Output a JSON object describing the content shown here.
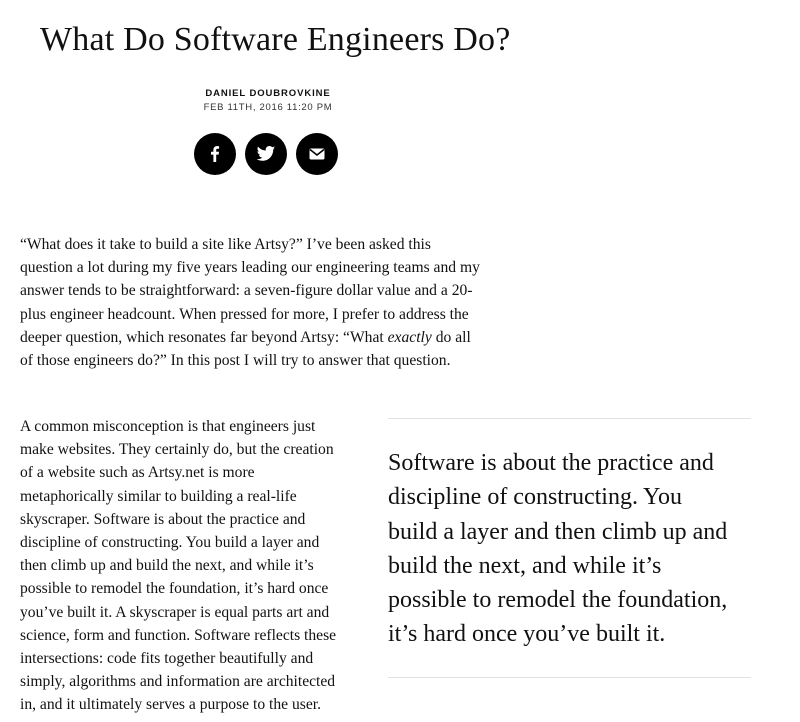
{
  "article": {
    "title": "What Do Software Engineers Do?",
    "author": "DANIEL DOUBROVKINE",
    "date": "FEB 11TH, 2016 11:20 PM"
  },
  "share": {
    "buttons": [
      {
        "name": "facebook",
        "icon": "facebook-icon"
      },
      {
        "name": "twitter",
        "icon": "twitter-icon"
      },
      {
        "name": "email",
        "icon": "envelope-icon"
      }
    ]
  },
  "intro": {
    "text_before": "“What does it take to build a site like Artsy?” I’ve been asked this\nquestion a lot during my five years leading our engineering teams and my\nanswer tends to be straightforward: a seven-figure dollar value and a 20-\nplus engineer headcount. When pressed for more, I prefer to address the\ndeeper question, which resonates far beyond Artsy: “What ",
    "emphasis": "exactly",
    "text_after": " do all\nof those engineers do?” In this post I will try to answer that question."
  },
  "body": {
    "paragraph": "A common misconception is that engineers just\nmake websites. They certainly do, but the creation\nof a website such as Artsy.net is more\nmetaphorically similar to building a real-life\nskyscraper. Software is about the practice and\ndiscipline of constructing. You build a layer and\nthen climb up and build the next, and while it’s\npossible to remodel the foundation, it’s hard once\nyou’ve built it. A skyscraper is equal parts art and\nscience, form and function. Software reflects these\nintersections: code fits together beautifully and\nsimply, algorithms and information are architected\nin, and it ultimately serves a purpose to the user."
  },
  "pullquote": {
    "text": "Software is about the practice and\ndiscipline of constructing. You\nbuild a layer and then climb up and\nbuild the next, and while it’s\npossible to remodel the foundation,\nit’s hard once you’ve built it."
  },
  "colors": {
    "text": "#111111",
    "button_bg": "#000000",
    "rule": "#e2e2e2"
  }
}
